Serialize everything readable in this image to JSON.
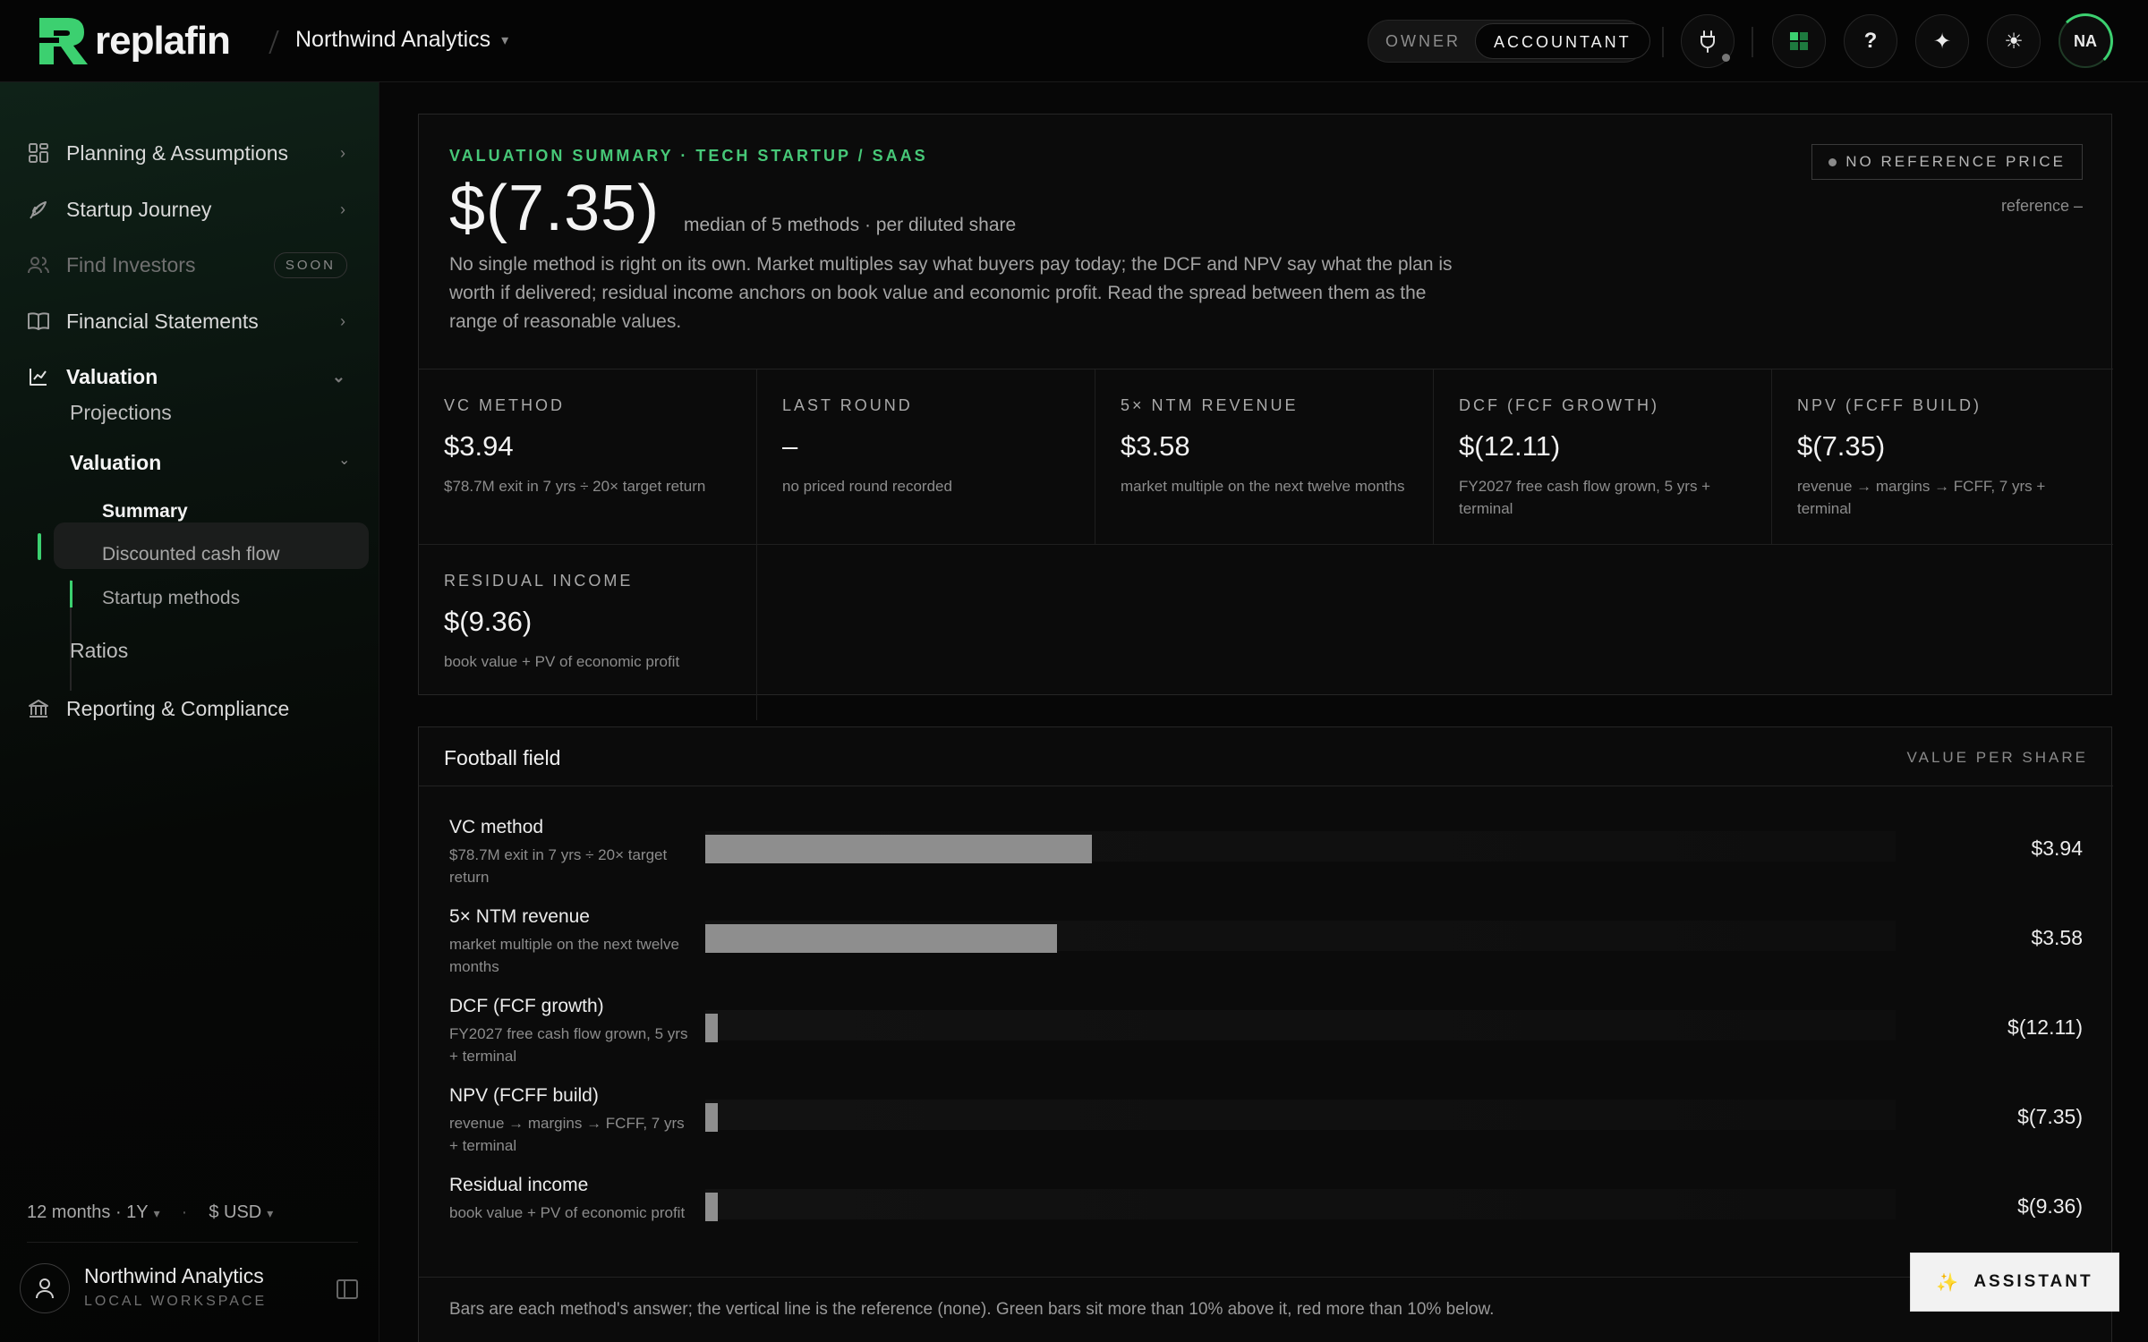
{
  "app": {
    "logo_text": "replafin",
    "workspace": "Northwind Analytics",
    "roles": [
      "OWNER",
      "ACCOUNTANT"
    ],
    "active_role": "ACCOUNTANT",
    "avatar_initials": "NA",
    "brand_color": "#3cd070"
  },
  "sidebar": {
    "items": [
      {
        "label": "Planning & Assumptions",
        "icon": "grid-icon"
      },
      {
        "label": "Startup Journey",
        "icon": "rocket-icon"
      },
      {
        "label": "Find Investors",
        "icon": "people-icon",
        "badge": "SOON"
      },
      {
        "label": "Financial Statements",
        "icon": "book-icon"
      },
      {
        "label": "Valuation",
        "icon": "chart-line-icon"
      }
    ],
    "valuation_children": [
      "Projections",
      "Valuation",
      "Ratios"
    ],
    "valuation_sub": [
      "Summary",
      "Discounted cash flow",
      "Startup methods"
    ],
    "reporting": "Reporting & Compliance",
    "period": "12 months · 1Y",
    "currency": "$ USD",
    "user_name": "Northwind Analytics",
    "user_sub": "LOCAL WORKSPACE"
  },
  "summary": {
    "kicker": "VALUATION SUMMARY · TECH STARTUP / SAAS",
    "value": "$(7.35)",
    "value_sub": "median of 5 methods · per diluted share",
    "description": "No single method is right on its own. Market multiples say what buyers pay today; the DCF and NPV say what the plan is worth if delivered; residual income anchors on book value and economic profit. Read the spread between them as the range of reasonable values.",
    "reference_badge": "NO REFERENCE PRICE",
    "reference_text": "reference –",
    "methods": [
      {
        "label": "VC METHOD",
        "value": "$3.94",
        "note": "$78.7M exit in 7 yrs ÷ 20× target return"
      },
      {
        "label": "LAST ROUND",
        "value": "–",
        "note": "no priced round recorded"
      },
      {
        "label": "5× NTM REVENUE",
        "value": "$3.58",
        "note": "market multiple on the next twelve months"
      },
      {
        "label": "DCF (FCF GROWTH)",
        "value": "$(12.11)",
        "note": "FY2027 free cash flow grown, 5 yrs + terminal"
      },
      {
        "label": "NPV (FCFF BUILD)",
        "value": "$(7.35)",
        "note": "revenue → margins → FCFF, 7 yrs + terminal"
      },
      {
        "label": "RESIDUAL INCOME",
        "value": "$(9.36)",
        "note": "book value + PV of economic profit"
      }
    ]
  },
  "football": {
    "title": "Football field",
    "right_label": "VALUE PER SHARE",
    "footnote": "Bars are each method's answer; the vertical line is the reference (none). Green bars sit more than 10% above it, red more than 10% below.",
    "bar_color": "#8e8e8e"
  },
  "chart_data": {
    "type": "bar",
    "categories": [
      "VC method",
      "5× NTM revenue",
      "DCF (FCF growth)",
      "NPV (FCFF build)",
      "Residual income"
    ],
    "notes": [
      "$78.7M exit in 7 yrs ÷ 20× target return",
      "market multiple on the next twelve months",
      "FY2027 free cash flow grown, 5 yrs + terminal",
      "revenue → margins → FCFF, 7 yrs + terminal",
      "book value + PV of economic profit"
    ],
    "values": [
      3.94,
      3.58,
      -12.11,
      -7.35,
      -9.36
    ],
    "value_labels": [
      "$3.94",
      "$3.58",
      "$(12.11)",
      "$(7.35)",
      "$(9.36)"
    ]
  },
  "assistant": {
    "label": "ASSISTANT"
  }
}
